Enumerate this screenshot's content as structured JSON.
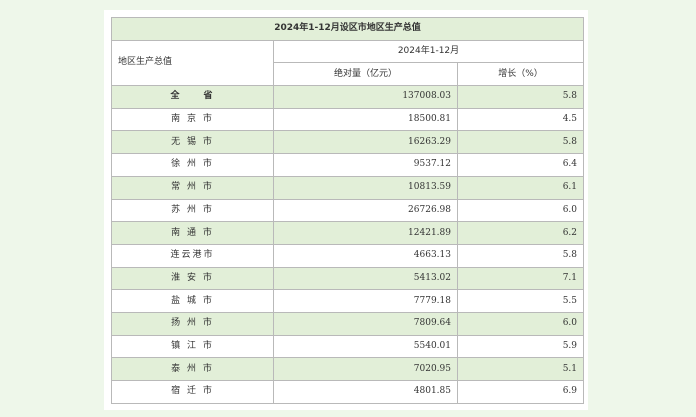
{
  "table": {
    "title": "2024年1-12月设区市地区生产总值",
    "row_header_label": "地区生产总值",
    "period_label": "2024年1-12月",
    "col_absolute": "绝对量（亿元）",
    "col_growth": "增长（%）",
    "rows": [
      {
        "name": "全　　省",
        "absolute": "137008.03",
        "growth": "5.8"
      },
      {
        "name": "南 京 市",
        "absolute": "18500.81",
        "growth": "4.5"
      },
      {
        "name": "无 锡 市",
        "absolute": "16263.29",
        "growth": "5.8"
      },
      {
        "name": "徐 州 市",
        "absolute": "9537.12",
        "growth": "6.4"
      },
      {
        "name": "常 州 市",
        "absolute": "10813.59",
        "growth": "6.1"
      },
      {
        "name": "苏 州 市",
        "absolute": "26726.98",
        "growth": "6.0"
      },
      {
        "name": "南 通 市",
        "absolute": "12421.89",
        "growth": "6.2"
      },
      {
        "name": "连云港市",
        "absolute": "4663.13",
        "growth": "5.8"
      },
      {
        "name": "淮 安 市",
        "absolute": "5413.02",
        "growth": "7.1"
      },
      {
        "name": "盐 城 市",
        "absolute": "7779.18",
        "growth": "5.5"
      },
      {
        "name": "扬 州 市",
        "absolute": "7809.64",
        "growth": "6.0"
      },
      {
        "name": "镇 江 市",
        "absolute": "5540.01",
        "growth": "5.9"
      },
      {
        "name": "泰 州 市",
        "absolute": "7020.95",
        "growth": "5.1"
      },
      {
        "name": "宿 迁 市",
        "absolute": "4801.85",
        "growth": "6.9"
      }
    ]
  }
}
